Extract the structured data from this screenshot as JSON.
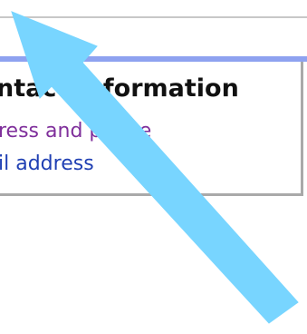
{
  "section": {
    "title": "ntact Information"
  },
  "links": [
    {
      "label": "ress and phone",
      "state": "visited"
    },
    {
      "label": "il address",
      "state": "unvisited"
    }
  ],
  "colors": {
    "accent_band": "#8ea2f0",
    "visited_link": "#7f2f9b",
    "unvisited_link": "#1f3fb3",
    "pointer": "#78d5ff"
  },
  "overlay": {
    "icon": "arrow-pointer-icon"
  }
}
